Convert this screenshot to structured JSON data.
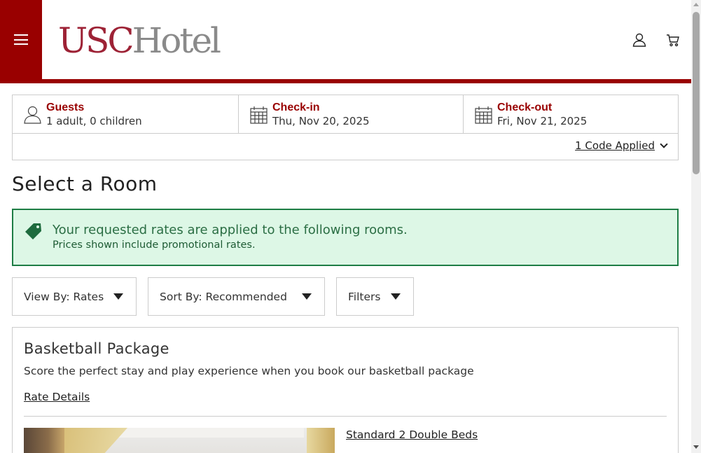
{
  "header": {
    "logo_primary": "USC",
    "logo_secondary": "Hotel",
    "menu_icon": "hamburger-icon",
    "account_icon": "user-icon",
    "cart_icon": "cart-icon"
  },
  "summary": {
    "guests": {
      "label": "Guests",
      "value": "1 adult, 0 children",
      "icon": "user-outline-icon"
    },
    "checkin": {
      "label": "Check-in",
      "value": "Thu, Nov 20, 2025",
      "icon": "calendar-icon"
    },
    "checkout": {
      "label": "Check-out",
      "value": "Fri, Nov 21, 2025",
      "icon": "calendar-icon"
    },
    "code_link": "1 Code Applied"
  },
  "page": {
    "title": "Select a Room"
  },
  "promo": {
    "icon": "tag-icon",
    "main": "Your requested rates are applied to the following rooms.",
    "sub": "Prices shown include promotional rates."
  },
  "controls": {
    "view_by": "View By: Rates",
    "sort_by": "Sort By: Recommended",
    "filters": "Filters"
  },
  "package": {
    "title": "Basketball Package",
    "description": "Score the perfect stay and play experience when you book our basketball package",
    "rate_details": "Rate Details",
    "room_name": "Standard 2 Double Beds"
  },
  "colors": {
    "brand": "#990000",
    "logo_red": "#9d2235",
    "logo_gray": "#8a8a8a",
    "promo_bg": "#ddf7e6",
    "promo_border": "#1e7d45"
  }
}
